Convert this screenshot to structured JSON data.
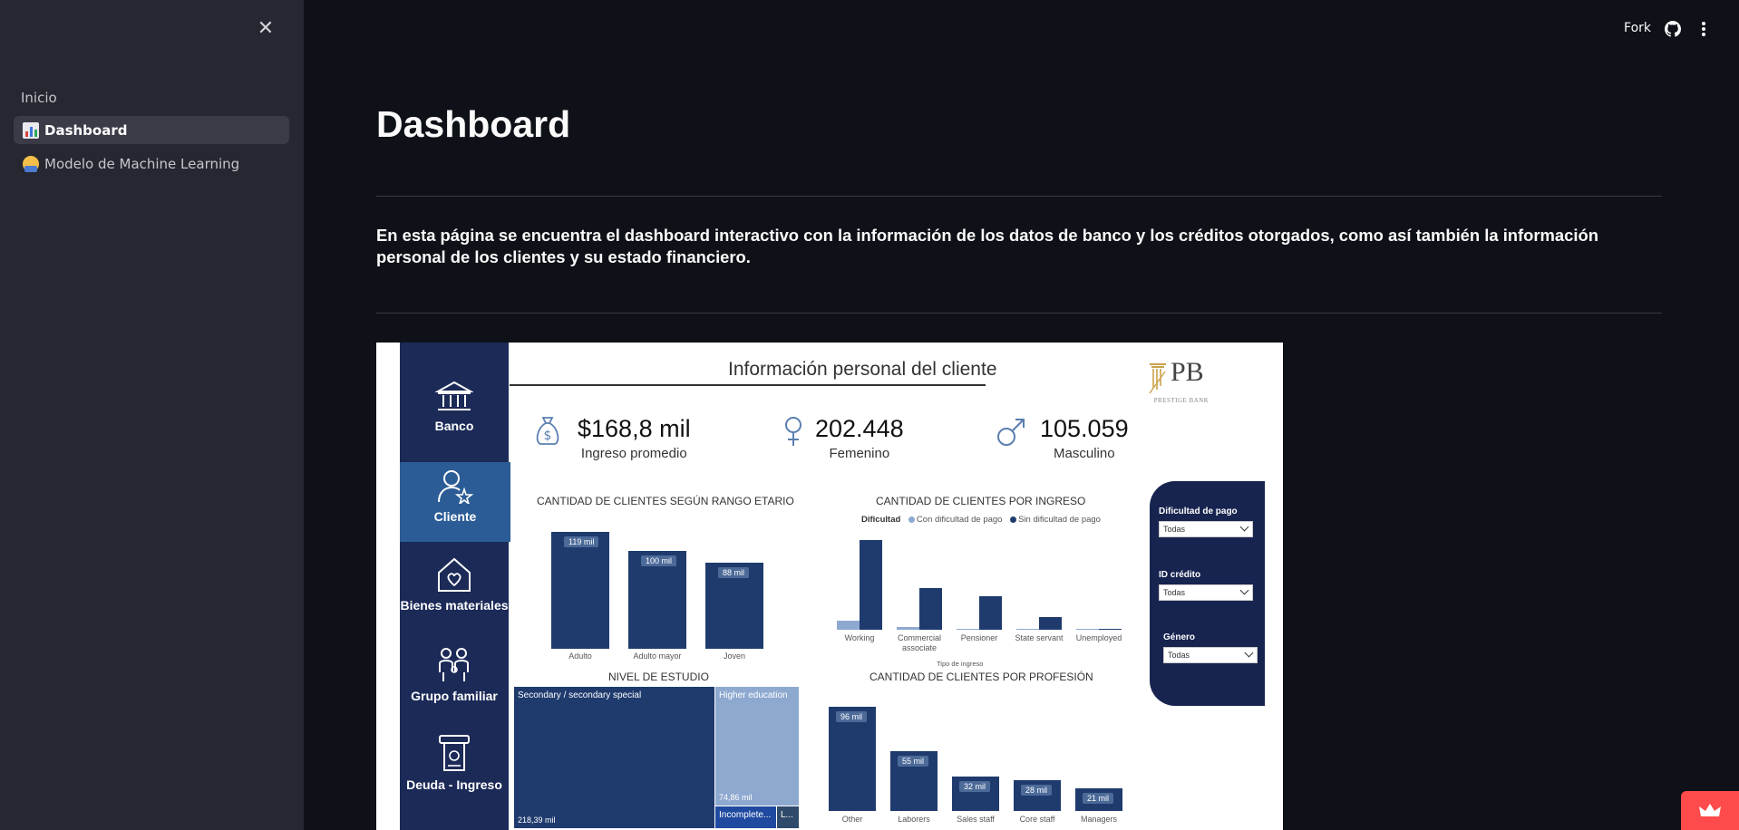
{
  "sidebar": {
    "section_label": "Inicio",
    "items": [
      {
        "label": "Dashboard",
        "icon": "bar-chart-emoji",
        "active": true
      },
      {
        "label": "Modelo de Machine Learning",
        "icon": "technologist-emoji",
        "active": false
      }
    ]
  },
  "header": {
    "fork_label": "Fork"
  },
  "main": {
    "title": "Dashboard",
    "description": "En esta página se encuentra el dashboard interactivo con la información de los datos de banco y los créditos otorgados, como así también la información personal de los clientes y su estado financiero."
  },
  "dashboard": {
    "nav": [
      {
        "label": "Banco",
        "icon": "bank-icon"
      },
      {
        "label": "Cliente",
        "icon": "client-icon",
        "active": true
      },
      {
        "label": "Bienes materiales",
        "icon": "house-heart-icon"
      },
      {
        "label": "Grupo familiar",
        "icon": "family-icon"
      },
      {
        "label": "Deuda - Ingreso",
        "icon": "atm-icon"
      }
    ],
    "title": "Información personal del cliente",
    "logo": {
      "letters": "PB",
      "tagline": "PRESTIGE BANK"
    },
    "kpis": [
      {
        "value": "$168,8 mil",
        "label": "Ingreso promedio",
        "icon": "money-bag-icon"
      },
      {
        "value": "202.448",
        "label": "Femenino",
        "icon": "female-icon"
      },
      {
        "value": "105.059",
        "label": "Masculino",
        "icon": "male-icon"
      }
    ],
    "filters": [
      {
        "label": "Dificultad de pago",
        "value": "Todas"
      },
      {
        "label": "ID crédito",
        "value": "Todas"
      },
      {
        "label": "Género",
        "value": "Todas"
      }
    ],
    "colors": {
      "navy": "#1b2a57",
      "bar": "#1f3b6e",
      "light": "#8ea9d0",
      "active_nav": "#2b5c96"
    }
  },
  "chart_data": [
    {
      "type": "bar",
      "title": "CANTIDAD DE CLIENTES SEGÚN RANGO ETARIO",
      "categories": [
        "Adulto",
        "Adulto mayor",
        "Joven"
      ],
      "values": [
        119,
        100,
        88
      ],
      "data_labels": [
        "119 mil",
        "100 mil",
        "88 mil"
      ],
      "ylim": [
        0,
        125
      ]
    },
    {
      "type": "bar",
      "title": "CANTIDAD DE CLIENTES POR INGRESO",
      "legend_title": "Dificultad",
      "xlabel": "Tipo de ingreso",
      "categories": [
        "Working",
        "Commercial associate",
        "Pensioner",
        "State servant",
        "Unemployed"
      ],
      "series": [
        {
          "name": "Con dificultad de pago",
          "color": "#8ea9d0",
          "values": [
            14,
            5,
            2,
            1,
            0.5
          ]
        },
        {
          "name": "Sin dificultad de pago",
          "color": "#1f3b6e",
          "values": [
            143,
            66,
            53,
            20,
            1
          ]
        }
      ],
      "ylim": [
        0,
        150
      ]
    },
    {
      "type": "heatmap",
      "title": "NIVEL DE ESTUDIO",
      "categories": [
        "Secondary / secondary special",
        "Higher education",
        "Incomplete...",
        "L..."
      ],
      "values": [
        218.39,
        74.86,
        10,
        4
      ],
      "data_labels": [
        "218,39 mil",
        "74,86 mil",
        "",
        ""
      ]
    },
    {
      "type": "bar",
      "title": "CANTIDAD DE CLIENTES POR PROFESIÓN",
      "categories": [
        "Other",
        "Laborers",
        "Sales staff",
        "Core staff",
        "Managers"
      ],
      "values": [
        96,
        55,
        32,
        28,
        21
      ],
      "data_labels": [
        "96 mil",
        "55 mil",
        "32 mil",
        "28 mil",
        "21 mil"
      ],
      "ylim": [
        0,
        100
      ]
    }
  ]
}
